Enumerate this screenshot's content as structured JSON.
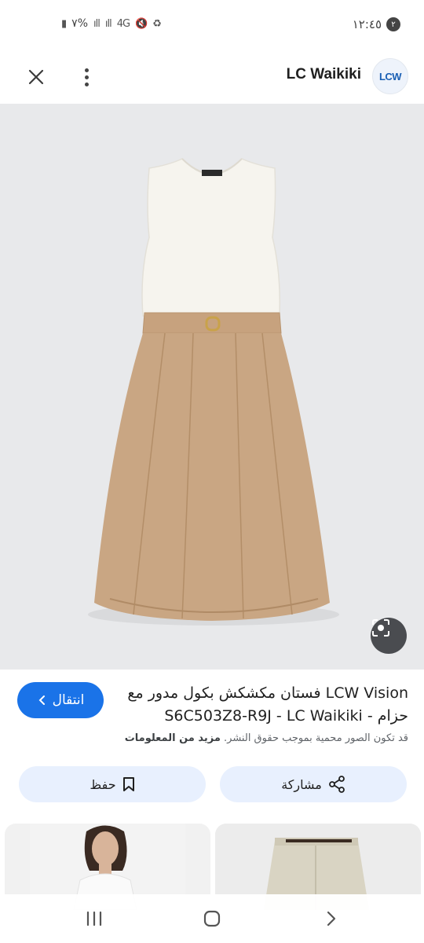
{
  "status_bar": {
    "time": "١٢:٤٥",
    "notification_count": "٢",
    "battery": "٧%",
    "network": "4G"
  },
  "app_bar": {
    "site_name": "LC Waikiki",
    "logo_text": "LCW"
  },
  "product": {
    "title": "LCW Vision فستان مكشكش بكول مدور مع حزام - S6C503Z8-R9J - LC Waikiki",
    "visit_label": "انتقال",
    "disclaimer": "قد تكون الصور محمية بموجب حقوق النشر.",
    "more_info": "مزيد من المعلومات"
  },
  "actions": {
    "share_label": "مشاركة",
    "save_label": "حفظ"
  },
  "icons": {
    "close": "close-icon",
    "more": "more-vert-icon",
    "lens": "lens-icon",
    "share": "share-icon",
    "bookmark": "bookmark-icon",
    "chevron": "chevron-left-icon",
    "nav_recent": "recent-apps-icon",
    "nav_home": "home-icon",
    "nav_back": "back-icon"
  },
  "colors": {
    "accent": "#1a73e8",
    "action_bg": "#e8f0fe",
    "hero_bg": "#e8e9eb",
    "skirt": "#c8a582",
    "top": "#f6f4ee"
  }
}
